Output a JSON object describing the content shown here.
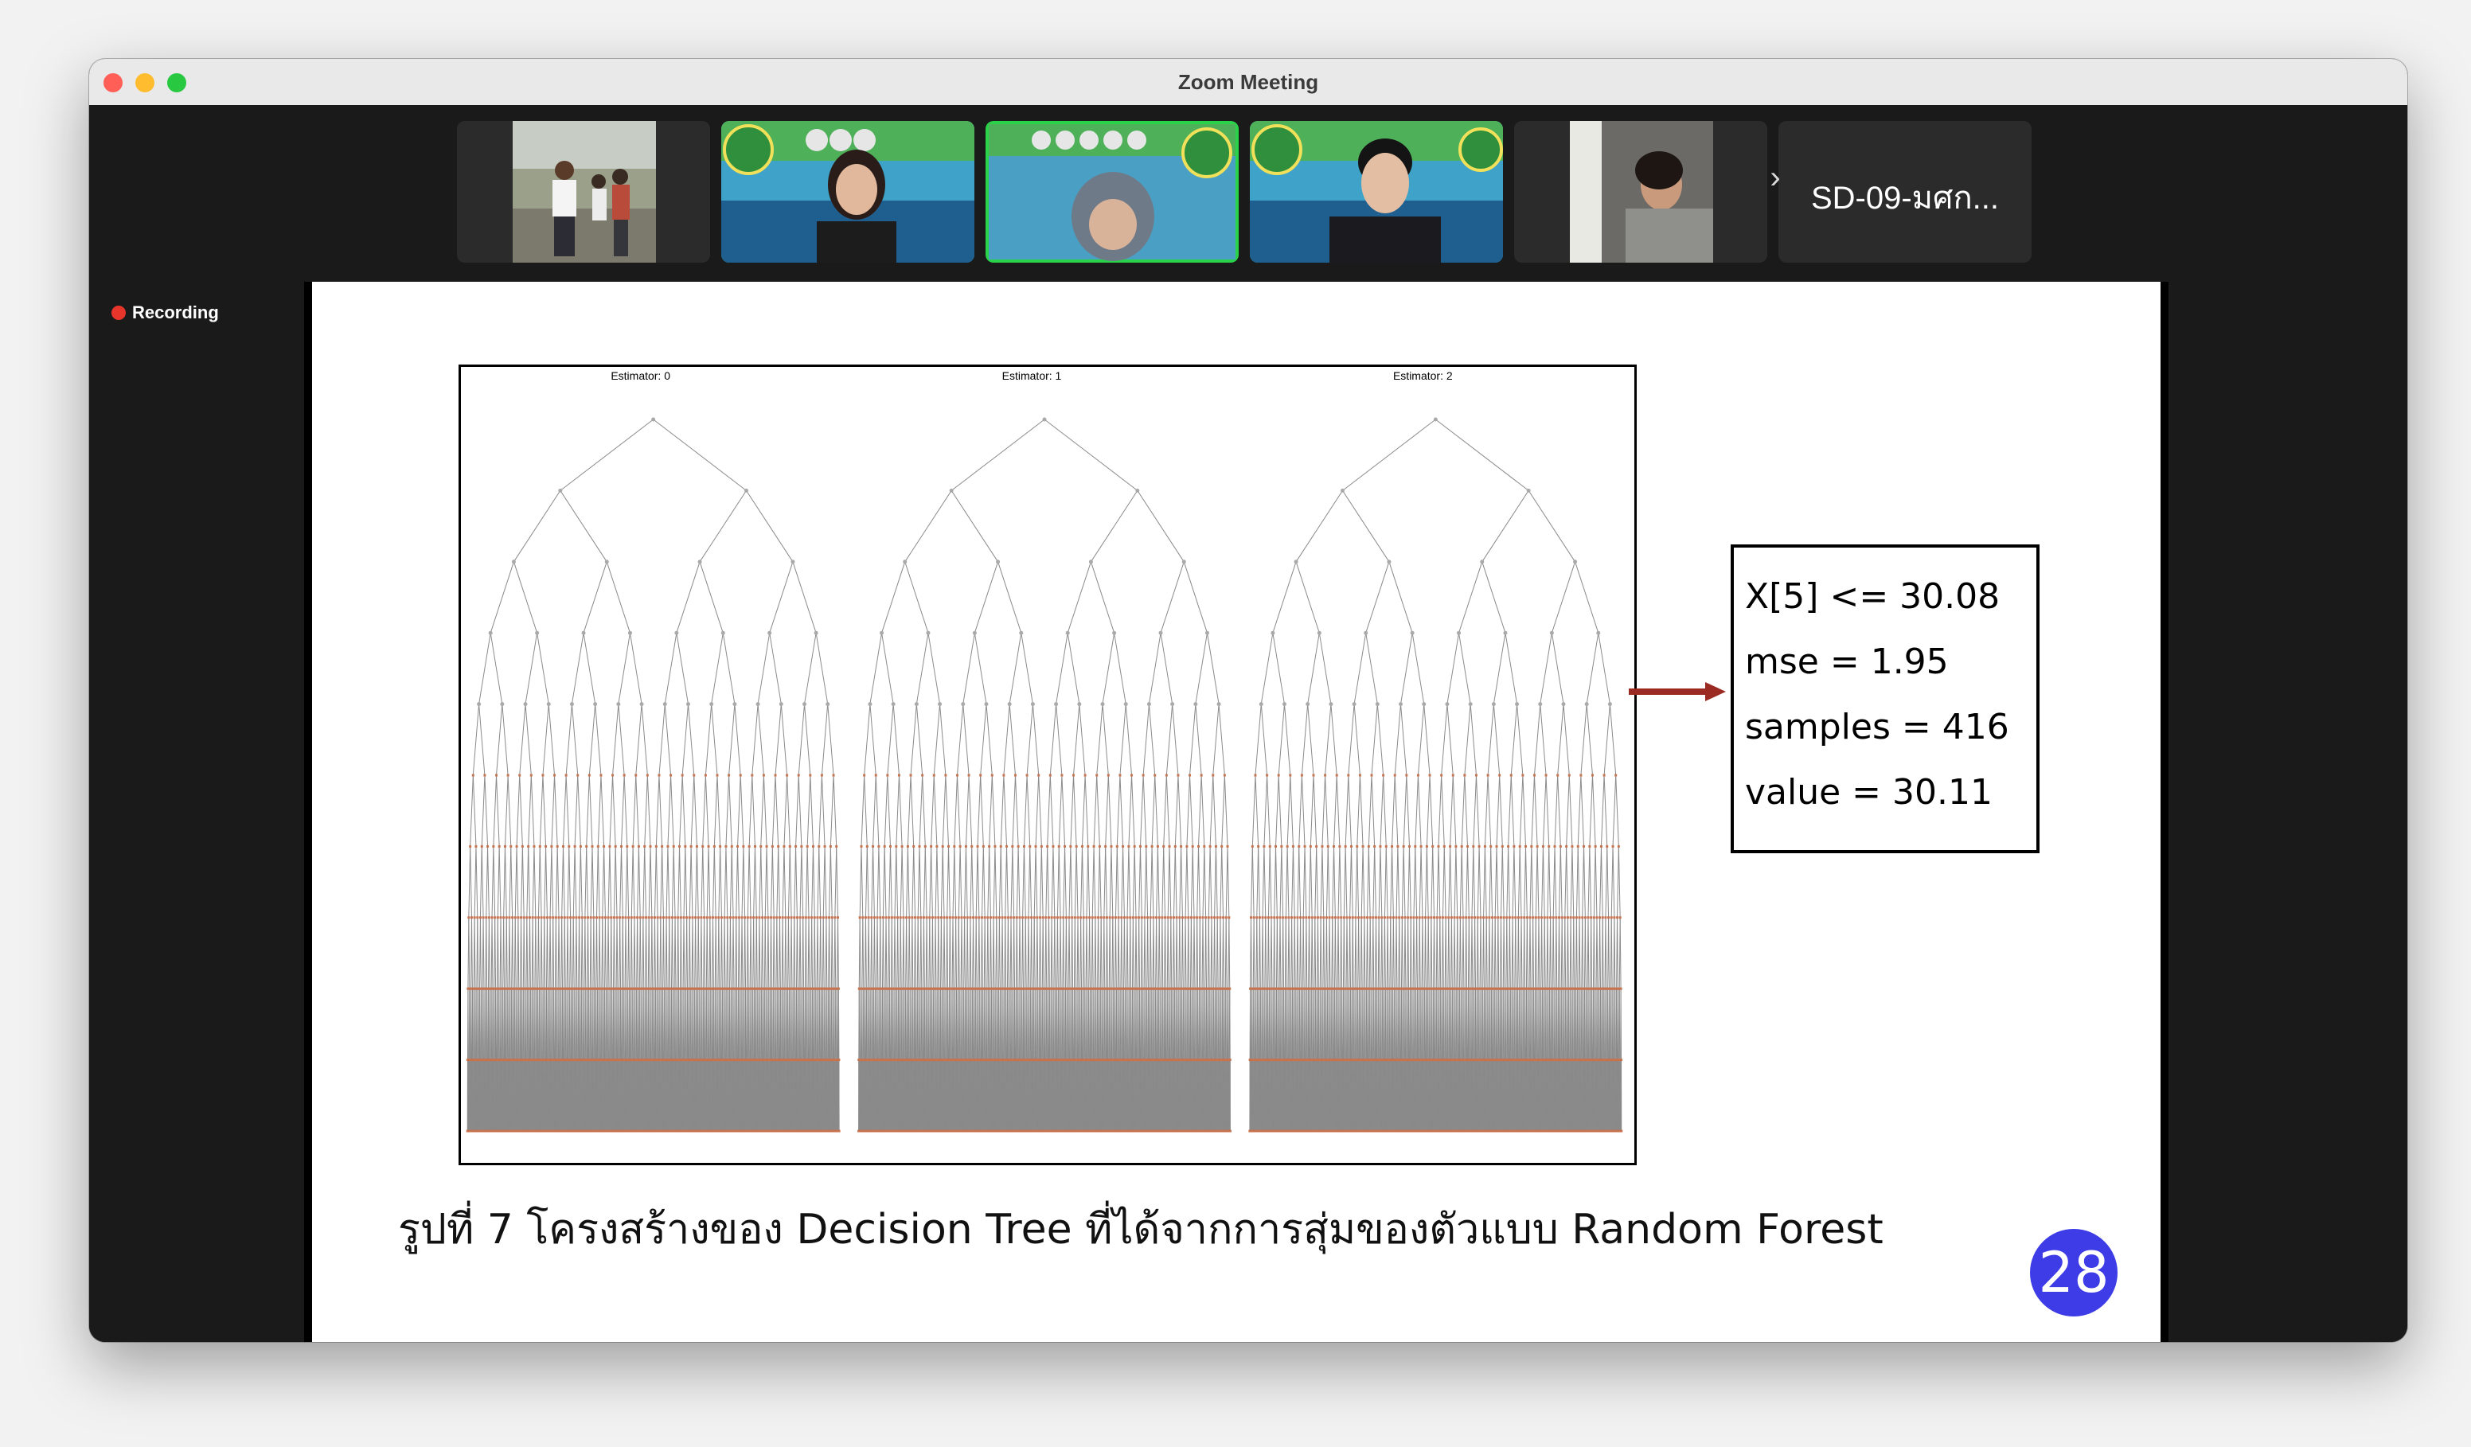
{
  "window": {
    "title": "Zoom Meeting"
  },
  "participants": [
    {
      "label": "",
      "scene": "outdoor-group"
    },
    {
      "label": "",
      "scene": "woman-speaker"
    },
    {
      "label": "",
      "scene": "hijab-speaker",
      "active": true
    },
    {
      "label": "",
      "scene": "man-speaker"
    },
    {
      "label": "",
      "scene": "woman-window"
    },
    {
      "label": "SD-09-มศก..."
    }
  ],
  "recording": {
    "label": "Recording",
    "color": "#e8352b"
  },
  "slide": {
    "estimators": [
      "Estimator: 0",
      "Estimator: 1",
      "Estimator: 2"
    ],
    "node_info": [
      "X[5] <= 30.08",
      "mse = 1.95",
      "samples = 416",
      "value = 30.11"
    ],
    "caption": "รูปที่ 7 โครงสร้างของ Decision Tree ที่ได้จากการสุ่มของตัวแบบ Random Forest",
    "page_number": "28",
    "arrow_color": "#9b2a22",
    "badge_color": "#3d3ce6"
  }
}
